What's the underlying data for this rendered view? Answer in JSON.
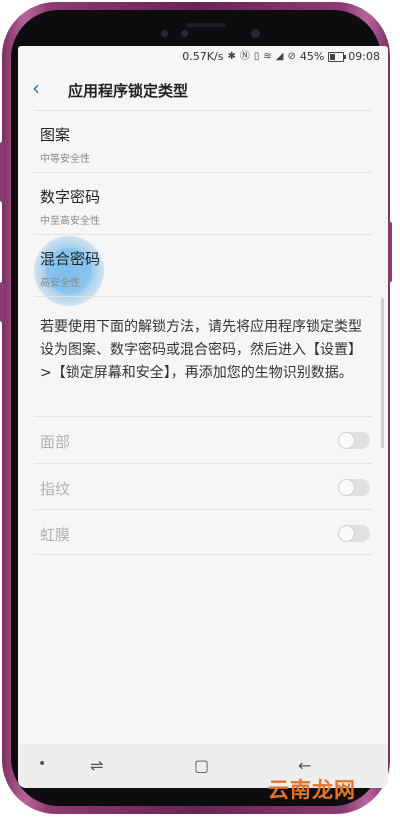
{
  "status_bar": {
    "speed": "0.57K/s",
    "battery_percent": "45%",
    "time": "09:08",
    "icons": [
      "bluetooth-icon",
      "nfc-icon",
      "vibrate-icon",
      "wifi-icon",
      "signal-icon",
      "no-disturb-icon",
      "battery-icon"
    ]
  },
  "header": {
    "back_icon": "chevron-left-icon",
    "title": "应用程序锁定类型"
  },
  "options": [
    {
      "title": "图案",
      "subtitle": "中等安全性"
    },
    {
      "title": "数字密码",
      "subtitle": "中至高安全性"
    },
    {
      "title": "混合密码",
      "subtitle": "高安全性"
    }
  ],
  "info_text": "若要使用下面的解锁方法，请先将应用程序锁定类型设为图案、数字密码或混合密码，然后进入【设置】>【锁定屏幕和安全】，再添加您的生物识别数据。",
  "biometrics": [
    {
      "label": "面部",
      "enabled": false
    },
    {
      "label": "指纹",
      "enabled": false
    },
    {
      "label": "虹膜",
      "enabled": false
    }
  ],
  "navbar": {
    "buttons": [
      "dot-icon",
      "recent-apps-icon",
      "home-icon",
      "back-icon"
    ]
  },
  "watermark": "云南龙网",
  "colors": {
    "accent": "#3b6fa6",
    "frame": "#7d2f63",
    "watermark": "#e4742a"
  }
}
